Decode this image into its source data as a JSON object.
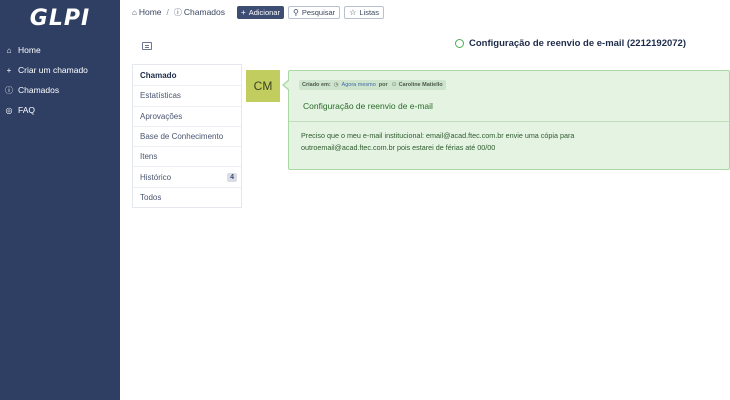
{
  "sidebar": {
    "logo": "GLPI",
    "items": [
      {
        "label": "Home",
        "icon": "home-icon"
      },
      {
        "label": "Criar um chamado",
        "icon": "plus-icon"
      },
      {
        "label": "Chamados",
        "icon": "info-circle-icon"
      },
      {
        "label": "FAQ",
        "icon": "lifebuoy-icon"
      }
    ]
  },
  "topbar": {
    "breadcrumb": [
      "Home",
      "Chamados"
    ],
    "buttons": {
      "add": "Adicionar",
      "search": "Pesquisar",
      "lists": "Listas"
    }
  },
  "ticket": {
    "title": "Configuração de reenvio de e-mail (2212192072)",
    "status_color": "#4caf50"
  },
  "tabs": [
    {
      "label": "Chamado",
      "active": true
    },
    {
      "label": "Estatísticas"
    },
    {
      "label": "Aprovações"
    },
    {
      "label": "Base de Conhecimento"
    },
    {
      "label": "Itens"
    },
    {
      "label": "Histórico",
      "badge": "4"
    },
    {
      "label": "Todos"
    }
  ],
  "timeline": {
    "avatar_initials": "CM",
    "avatar_color": "#c2cd5f",
    "meta": {
      "created_label": "Criado em:",
      "when": "Agora mesmo",
      "by_label": "por",
      "author": "Caroline Matiello"
    },
    "title": "Configuração de reenvio de e-mail",
    "body_line1": "Preciso que o meu e-mail institucional: email@acad.ftec.com.br envie uma cópia para",
    "body_line2": "outroemail@acad.ftec.com.br pois estarei de férias até 00/00"
  }
}
